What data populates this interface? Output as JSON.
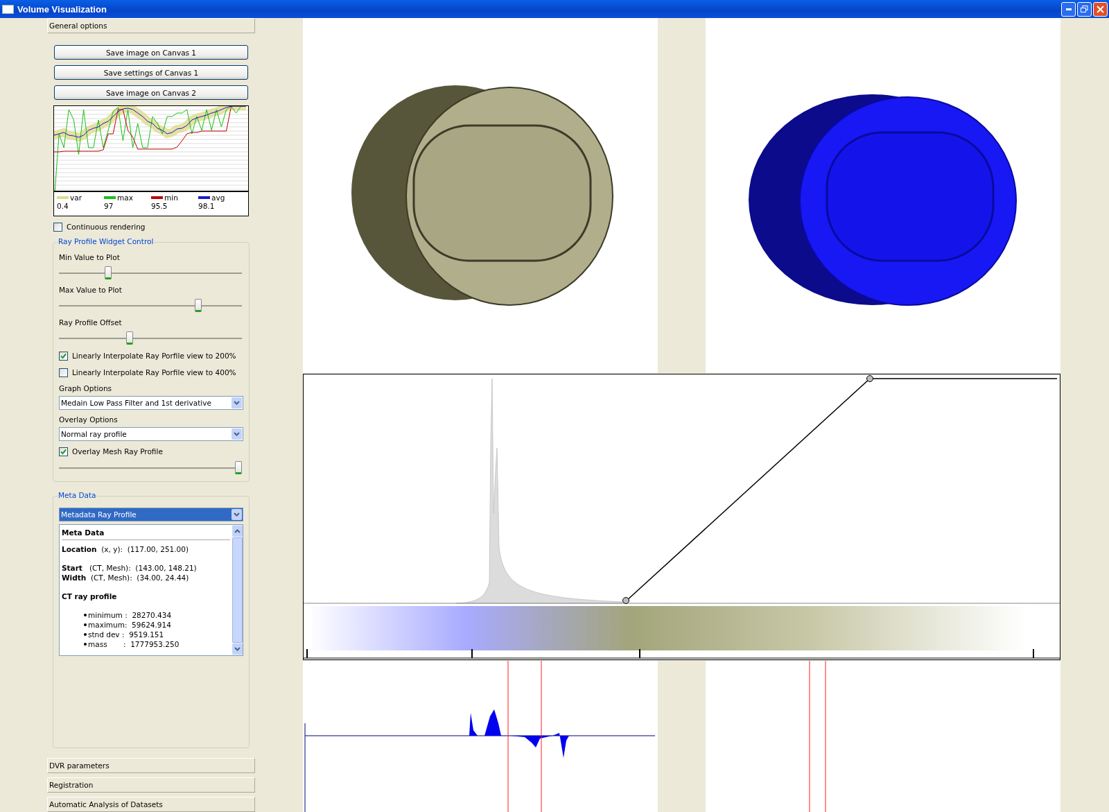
{
  "window": {
    "title": "Volume Visualization"
  },
  "sidebar": {
    "top_sections": [
      {
        "label": "General options"
      }
    ],
    "buttons": [
      "Save image on Canvas 1",
      "Save settings of Canvas 1",
      "Save image on Canvas 2"
    ],
    "stats_legend": [
      {
        "label": "var",
        "value": "0.4",
        "color": "#e0db8c"
      },
      {
        "label": "max",
        "value": "97",
        "color": "#19c019"
      },
      {
        "label": "min",
        "value": "95.5",
        "color": "#c00000"
      },
      {
        "label": "avg",
        "value": "98.1",
        "color": "#1a1acc"
      }
    ],
    "continuous_rendering": {
      "label": "Continuous rendering",
      "checked": false
    },
    "ray_profile_control": {
      "title": "Ray Profile Widget Control",
      "controls": [
        {
          "kind": "label",
          "text": "Min Value to Plot"
        },
        {
          "kind": "slider",
          "level": 0.26
        },
        {
          "kind": "label",
          "text": "Max Value to Plot"
        },
        {
          "kind": "slider",
          "level": 0.77
        },
        {
          "kind": "label",
          "text": "Ray Profile Offset"
        },
        {
          "kind": "slider",
          "level": 0.38
        },
        {
          "kind": "checkbox",
          "label": "Linearly Interpolate Ray Porfile view to 200%",
          "checked": true
        },
        {
          "kind": "checkbox",
          "label": "Linearly Interpolate Ray Porfile view to 400%",
          "checked": false
        },
        {
          "kind": "label",
          "text": "Graph Options"
        },
        {
          "kind": "dropdown",
          "value": "Medain Low Pass Filter and 1st derivative"
        },
        {
          "kind": "label",
          "text": "Overlay Options"
        },
        {
          "kind": "dropdown",
          "value": "Normal ray profile"
        },
        {
          "kind": "checkbox",
          "label": "Overlay Mesh Ray Profile",
          "checked": true
        },
        {
          "kind": "slider",
          "level": 1.0
        }
      ]
    },
    "meta_data": {
      "title": "Meta Data",
      "dropdown": {
        "value": "Metadata Ray Profile",
        "focused": true
      },
      "panel": {
        "heading": "Meta Data",
        "groups": [
          {
            "lines": [
              {
                "kind": "field",
                "text": "**Location**  (x, y):  (117.00, 251.00)"
              }
            ]
          },
          {
            "lines": [
              {
                "kind": "field",
                "text": "**Start**   (CT, Mesh):  (143.00, 148.21)"
              },
              {
                "kind": "field",
                "text": "**Width**  (CT, Mesh):  (34.00, 24.44)"
              }
            ]
          },
          {
            "lines": [
              {
                "kind": "heading",
                "text": "CT ray profile"
              }
            ]
          },
          {
            "lines": [
              {
                "kind": "bullet",
                "text": "minimum :  28270.434"
              },
              {
                "kind": "bullet",
                "text": "maximum:  59624.914"
              },
              {
                "kind": "bullet",
                "text": "stnd dev :  9519.151"
              },
              {
                "kind": "bullet",
                "text": "mass       :  1777953.250"
              }
            ]
          }
        ]
      }
    },
    "bottom_sections": [
      {
        "label": "DVR parameters"
      },
      {
        "label": "Registration"
      },
      {
        "label": "Automatic Analysis of Datasets"
      }
    ]
  }
}
